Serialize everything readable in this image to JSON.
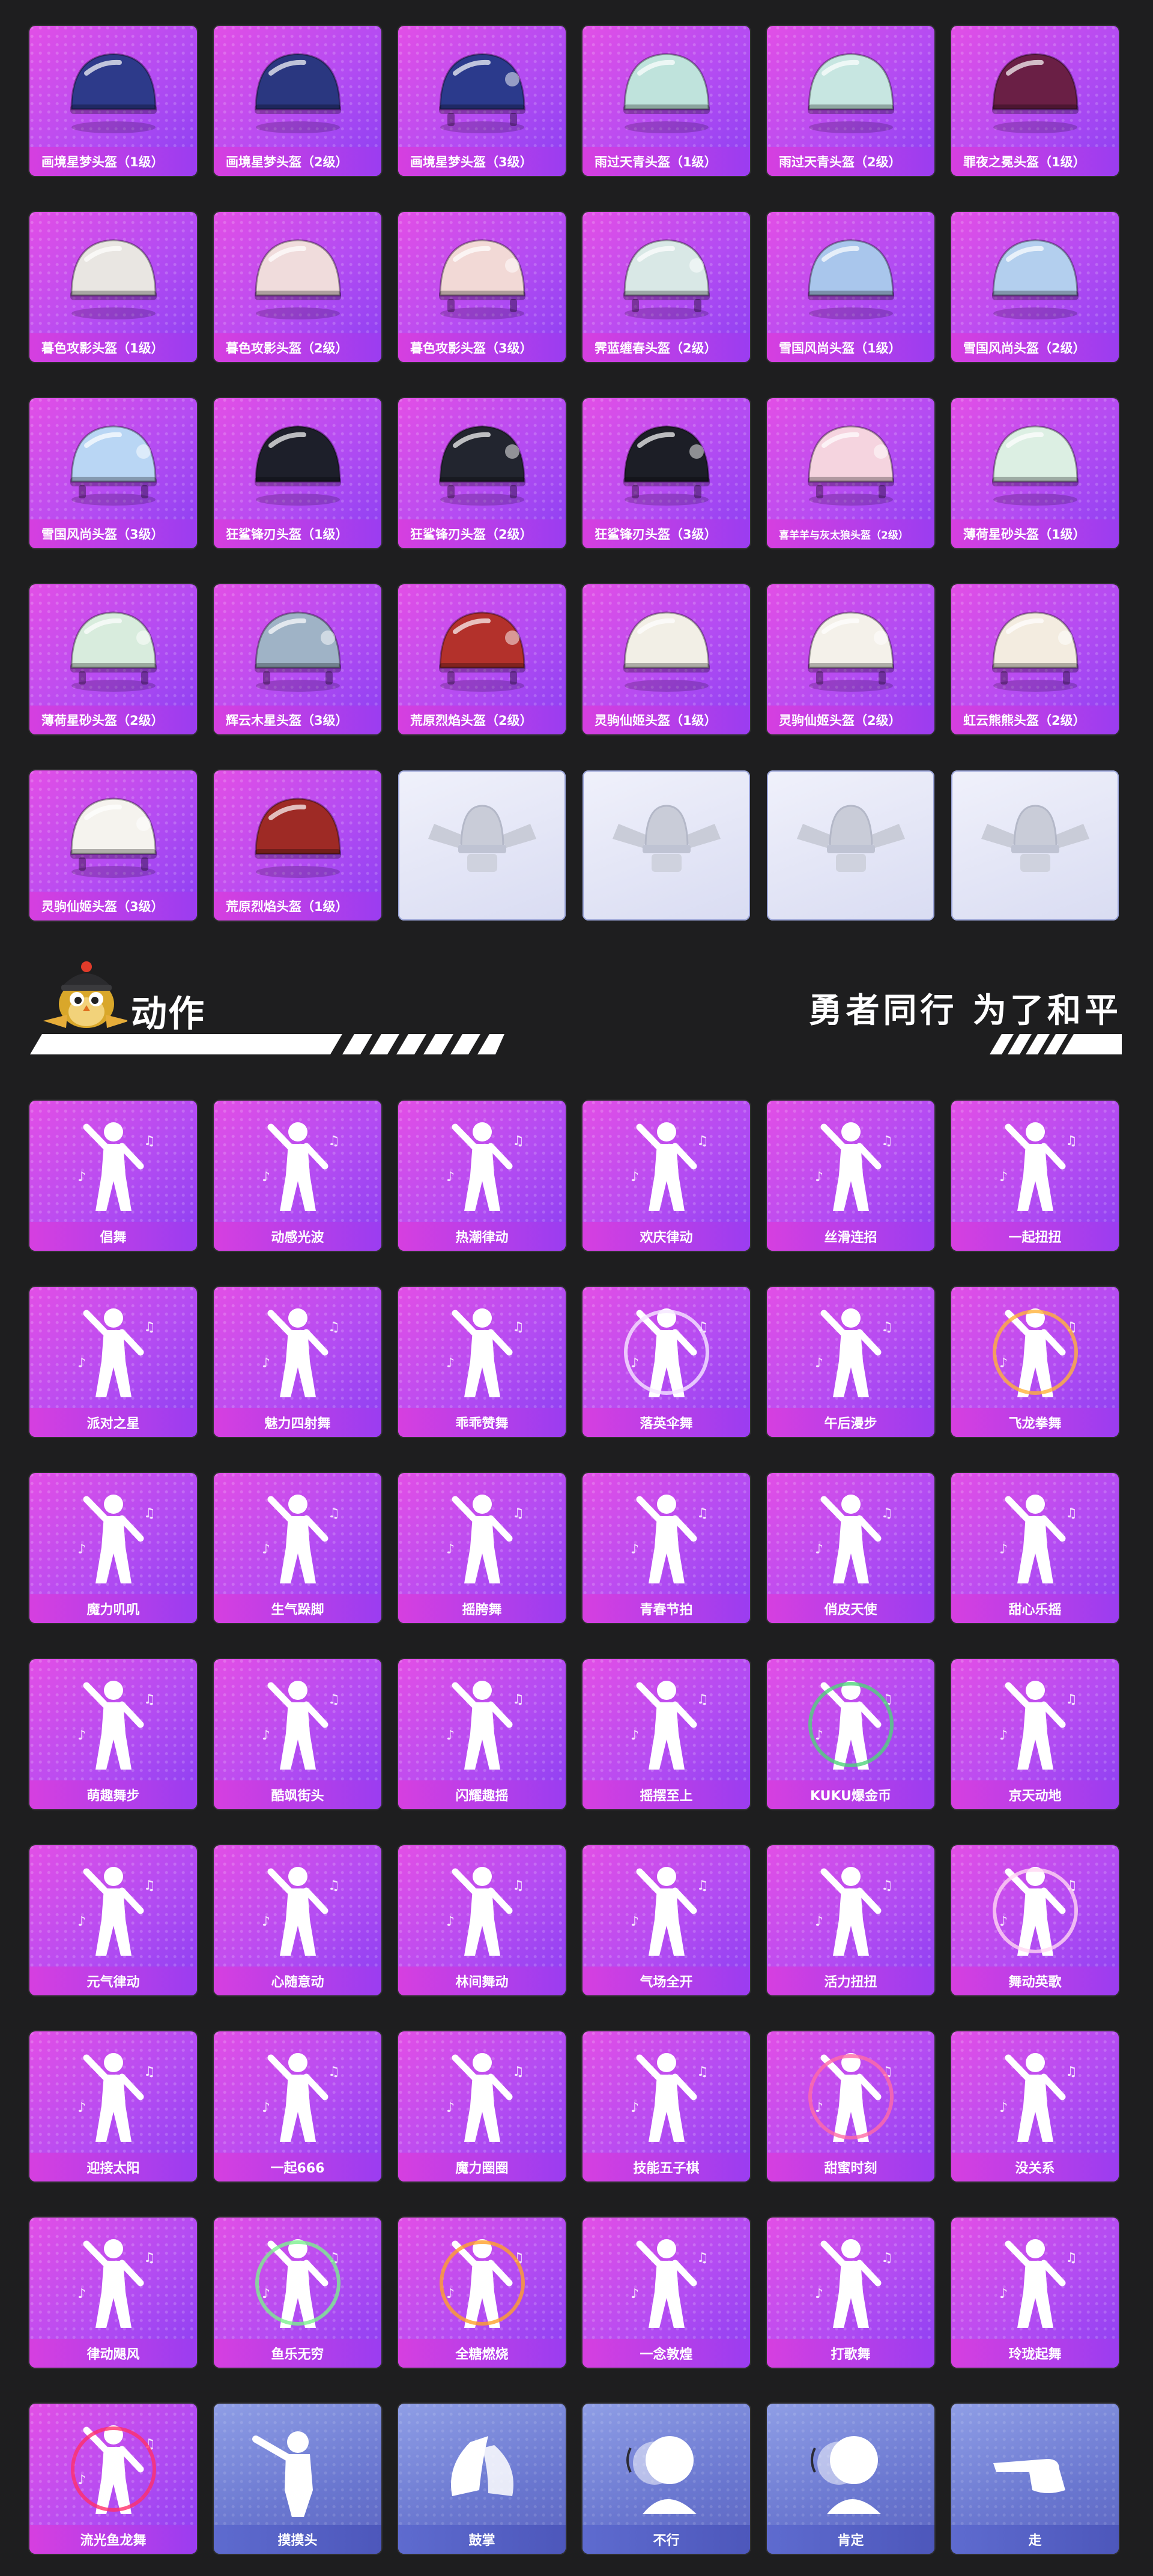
{
  "helmets": [
    {
      "label": "画境星梦头盔（1级）",
      "icon": "helmet-icon",
      "variant": "purple",
      "tone": "#2d3a8a"
    },
    {
      "label": "画境星梦头盔（2级）",
      "icon": "helmet-icon",
      "variant": "purple",
      "tone": "#2a3780"
    },
    {
      "label": "画境星梦头盔（3级）",
      "icon": "military-helmet-icon",
      "variant": "purple",
      "tone": "#2b3a8c"
    },
    {
      "label": "雨过天青头盔（1级）",
      "icon": "helmet-icon",
      "variant": "purple",
      "tone": "#bfe3dc"
    },
    {
      "label": "雨过天青头盔（2级）",
      "icon": "helmet-icon",
      "variant": "purple",
      "tone": "#c7e6e1"
    },
    {
      "label": "罪夜之冕头盔（1级）",
      "icon": "helmet-icon",
      "variant": "purple",
      "tone": "#6a1f45"
    },
    {
      "label": "暮色攻影头盔（1级）",
      "icon": "helmet-icon",
      "variant": "purple",
      "tone": "#e9e6e2"
    },
    {
      "label": "暮色攻影头盔（2级）",
      "icon": "helmet-icon",
      "variant": "purple",
      "tone": "#f0dcdc"
    },
    {
      "label": "暮色攻影头盔（3级）",
      "icon": "military-helmet-icon",
      "variant": "purple",
      "tone": "#f2d9d6"
    },
    {
      "label": "霁蓝缠春头盔（2级）",
      "icon": "military-helmet-icon",
      "variant": "purple",
      "tone": "#d9e8e6"
    },
    {
      "label": "雪国风尚头盔（1级）",
      "icon": "helmet-icon",
      "variant": "purple",
      "tone": "#a9c6ec"
    },
    {
      "label": "雪国风尚头盔（2级）",
      "icon": "helmet-icon",
      "variant": "purple",
      "tone": "#b3cfee"
    },
    {
      "label": "雪国风尚头盔（3级）",
      "icon": "military-helmet-icon",
      "variant": "purple",
      "tone": "#b9d6f4"
    },
    {
      "label": "狂鲨锋刃头盔（1级）",
      "icon": "helmet-icon",
      "variant": "purple",
      "tone": "#1d1f2a"
    },
    {
      "label": "狂鲨锋刃头盔（2级）",
      "icon": "military-helmet-icon",
      "variant": "purple",
      "tone": "#22252f"
    },
    {
      "label": "狂鲨锋刃头盔（3级）",
      "icon": "military-helmet-icon",
      "variant": "purple",
      "tone": "#1c1e26"
    },
    {
      "label": "喜羊羊与灰太狼头盔（2级）",
      "icon": "military-helmet-icon",
      "variant": "purple",
      "tone": "#f5d4df",
      "small": true
    },
    {
      "label": "薄荷星砂头盔（1级）",
      "icon": "helmet-icon",
      "variant": "purple",
      "tone": "#dcefe3"
    },
    {
      "label": "薄荷星砂头盔（2级）",
      "icon": "military-helmet-icon",
      "variant": "purple",
      "tone": "#d8ecdd"
    },
    {
      "label": "辉云木星头盔（3级）",
      "icon": "military-helmet-icon",
      "variant": "purple",
      "tone": "#9fb3c6"
    },
    {
      "label": "荒原烈焰头盔（2级）",
      "icon": "military-helmet-icon",
      "variant": "purple",
      "tone": "#b3312b"
    },
    {
      "label": "灵驹仙姬头盔（1级）",
      "icon": "helmet-icon",
      "variant": "purple",
      "tone": "#f2efe6"
    },
    {
      "label": "灵驹仙姬头盔（2级）",
      "icon": "military-helmet-icon",
      "variant": "purple",
      "tone": "#f4f1ea"
    },
    {
      "label": "虹云熊熊头盔（2级）",
      "icon": "military-helmet-icon",
      "variant": "purple",
      "tone": "#f3ece0"
    },
    {
      "label": "灵驹仙姬头盔（3级）",
      "icon": "military-helmet-icon",
      "variant": "purple",
      "tone": "#f5f3ee"
    },
    {
      "label": "荒原烈焰头盔（1级）",
      "icon": "helmet-icon",
      "variant": "purple",
      "tone": "#9e2a25"
    },
    {
      "label": "",
      "icon": "emblem-icon",
      "variant": "placeholder",
      "tone": "#c9ccd8"
    },
    {
      "label": "",
      "icon": "emblem-icon",
      "variant": "placeholder",
      "tone": "#c9ccd8"
    },
    {
      "label": "",
      "icon": "emblem-icon",
      "variant": "placeholder",
      "tone": "#c9ccd8"
    },
    {
      "label": "",
      "icon": "emblem-icon",
      "variant": "placeholder",
      "tone": "#c9ccd8"
    }
  ],
  "action_section": {
    "title": "动作",
    "slogan": "勇者同行 为了和平",
    "mascot_icon": "owl-mascot-icon"
  },
  "actions": [
    {
      "label": "倡舞",
      "icon": "dance-figure-icon",
      "variant": "purple"
    },
    {
      "label": "动感光波",
      "icon": "dance-figure-icon",
      "variant": "purple"
    },
    {
      "label": "热潮律动",
      "icon": "dance-figure-icon",
      "variant": "purple"
    },
    {
      "label": "欢庆律动",
      "icon": "dance-figure-icon",
      "variant": "purple"
    },
    {
      "label": "丝滑连招",
      "icon": "dance-figure-icon",
      "variant": "purple"
    },
    {
      "label": "一起扭扭",
      "icon": "dance-figure-icon",
      "variant": "purple"
    },
    {
      "label": "派对之星",
      "icon": "dance-figure-icon",
      "variant": "purple"
    },
    {
      "label": "魅力四射舞",
      "icon": "dance-figure-icon",
      "variant": "purple"
    },
    {
      "label": "乖乖赞舞",
      "icon": "dance-figure-icon",
      "variant": "purple"
    },
    {
      "label": "落英伞舞",
      "icon": "umbrella-dance-icon",
      "variant": "purple"
    },
    {
      "label": "午后漫步",
      "icon": "dance-figure-icon",
      "variant": "purple"
    },
    {
      "label": "飞龙拳舞",
      "icon": "dragon-dance-icon",
      "variant": "purple"
    },
    {
      "label": "魔力叽叽",
      "icon": "dance-figure-icon",
      "variant": "purple"
    },
    {
      "label": "生气跺脚",
      "icon": "dance-figure-icon",
      "variant": "purple"
    },
    {
      "label": "摇胯舞",
      "icon": "dance-figure-icon",
      "variant": "purple"
    },
    {
      "label": "青春节拍",
      "icon": "dance-figure-icon",
      "variant": "purple"
    },
    {
      "label": "俏皮天使",
      "icon": "dance-figure-icon",
      "variant": "purple"
    },
    {
      "label": "甜心乐摇",
      "icon": "dance-figure-icon",
      "variant": "purple"
    },
    {
      "label": "萌趣舞步",
      "icon": "dance-figure-icon",
      "variant": "purple"
    },
    {
      "label": "酷飒街头",
      "icon": "dance-figure-icon",
      "variant": "purple"
    },
    {
      "label": "闪耀趣摇",
      "icon": "dance-figure-icon",
      "variant": "purple"
    },
    {
      "label": "摇摆至上",
      "icon": "dance-figure-icon",
      "variant": "purple"
    },
    {
      "label": "KUKU爆金币",
      "icon": "money-dance-icon",
      "variant": "purple"
    },
    {
      "label": "京天动地",
      "icon": "dance-figure-icon",
      "variant": "purple"
    },
    {
      "label": "元气律动",
      "icon": "dance-figure-icon",
      "variant": "purple"
    },
    {
      "label": "心随意动",
      "icon": "dance-figure-icon",
      "variant": "purple"
    },
    {
      "label": "林间舞动",
      "icon": "dance-figure-icon",
      "variant": "purple"
    },
    {
      "label": "气场全开",
      "icon": "dance-figure-icon",
      "variant": "purple"
    },
    {
      "label": "活力扭扭",
      "icon": "dance-figure-icon",
      "variant": "purple"
    },
    {
      "label": "舞动英歌",
      "icon": "bubble-dance-icon",
      "variant": "purple"
    },
    {
      "label": "迎接太阳",
      "icon": "dance-figure-icon",
      "variant": "purple"
    },
    {
      "label": "一起666",
      "icon": "dance-figure-icon",
      "variant": "purple"
    },
    {
      "label": "魔力圈圈",
      "icon": "dance-figure-icon",
      "variant": "purple"
    },
    {
      "label": "技能五子棋",
      "icon": "dance-figure-icon",
      "variant": "purple"
    },
    {
      "label": "甜蜜时刻",
      "icon": "heart-dance-icon",
      "variant": "purple"
    },
    {
      "label": "没关系",
      "icon": "dance-figure-icon",
      "variant": "purple"
    },
    {
      "label": "律动飓风",
      "icon": "dance-figure-icon",
      "variant": "purple"
    },
    {
      "label": "鱼乐无穷",
      "icon": "fish-dance-icon",
      "variant": "purple"
    },
    {
      "label": "全糖燃烧",
      "icon": "flame-dance-icon",
      "variant": "purple"
    },
    {
      "label": "一念敦煌",
      "icon": "dance-figure-icon",
      "variant": "purple"
    },
    {
      "label": "打歌舞",
      "icon": "dance-figure-icon",
      "variant": "purple"
    },
    {
      "label": "玲珑起舞",
      "icon": "dance-figure-icon",
      "variant": "purple"
    },
    {
      "label": "流光鱼龙舞",
      "icon": "red-dragon-dance-icon",
      "variant": "purple"
    },
    {
      "label": "摸摸头",
      "icon": "pat-head-icon",
      "variant": "blue"
    },
    {
      "label": "鼓掌",
      "icon": "clap-hands-icon",
      "variant": "blue"
    },
    {
      "label": "不行",
      "icon": "no-gesture-icon",
      "variant": "blue"
    },
    {
      "label": "肯定",
      "icon": "nod-gesture-icon",
      "variant": "blue"
    },
    {
      "label": "走",
      "icon": "point-hand-icon",
      "variant": "blue"
    }
  ]
}
